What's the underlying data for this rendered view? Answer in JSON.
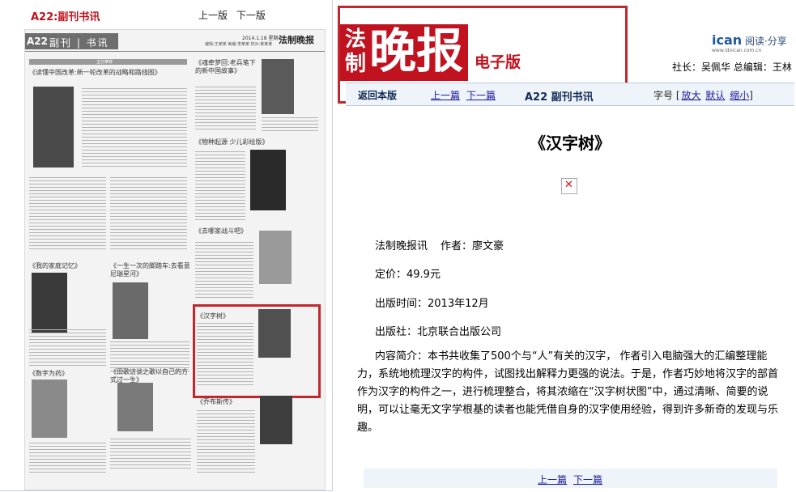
{
  "left_panel": {
    "title": "A22:副刊书讯",
    "nav": {
      "prev": "上一版",
      "next": "下一版"
    },
    "newspaper": {
      "page_number": "A22",
      "section": "副刊 | 书讯",
      "date": "2014.1.18 星期五",
      "subline": "编辑:王某某  美编:李某某  校对:某某某",
      "logo": "法制晚报",
      "column_header": "主打推荐",
      "headlines": {
        "lead": "《读懂中国改革:新一轮改革的战略和路线图》",
        "canglang": "《魂牵梦回:老兵笔下的新中国故事》",
        "biology": "《物种起源 少儿彩绘版》",
        "jiayuan": "《我的家庭记忆》",
        "trip": "《一生一次的脚踏车:去看意尼瑞星河》",
        "lonely": "《去哪家战斗吧》",
        "hanzi": "《汉字树》",
        "teeth": "《数字为药》",
        "tianye": "《田歌访谈之歌以自己的方式过一生》",
        "qiao": "《乔布斯传》"
      }
    }
  },
  "right_panel": {
    "logo": {
      "fazhi": "法制",
      "wanbao": "晚报",
      "edition": "电子版"
    },
    "ican": {
      "brand": "ican",
      "tagline": "阅读·分享",
      "sub": "www.idoican.com.cn"
    },
    "editors": "社长：吴佩华 总编辑：王林",
    "navbar": {
      "back": "返回本版",
      "prev": "上一篇",
      "next": "下一篇",
      "page": "A22 副刊书讯",
      "font_size_label": "字号",
      "font_options": [
        "放大",
        "默认",
        "缩小"
      ]
    },
    "article": {
      "title": "《汉字树》",
      "source": "法制晚报讯",
      "author": "作者：廖文豪",
      "price": "定价：49.9元",
      "pub_date": "出版时间：2013年12月",
      "publisher": "出版社：北京联合出版公司",
      "intro": "内容简介：本书共收集了500个与“人”有关的汉字， 作者引入电脑强大的汇编整理能力，系统地梳理汉字的构件，试图找出解释力更强的说法。于是，作者巧妙地将汉字的部首作为汉字的构件之一，进行梳理整合，将其浓缩在“汉字树状图”中，通过清晰、简要的说明，可以让毫无文字学根基的读者也能凭借自身的汉字使用经验，得到许多新奇的发现与乐趣。"
    },
    "bottom_nav": {
      "prev": "上一篇",
      "next": "下一篇"
    }
  },
  "colors": {
    "brand_red": "#c1121f",
    "highlight_red": "#c1272d",
    "nav_bg": "#eef4fa",
    "link": "#1a1a9a"
  }
}
